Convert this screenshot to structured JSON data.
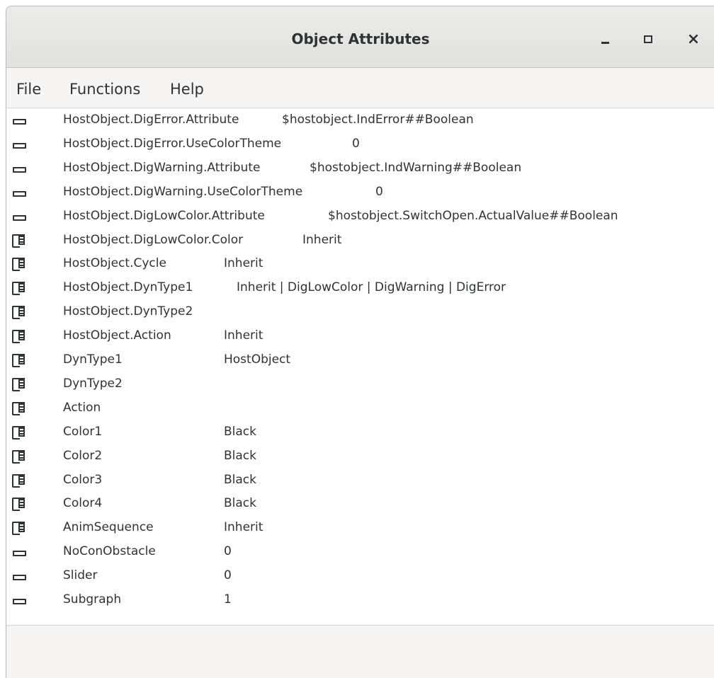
{
  "window": {
    "title": "Object Attributes"
  },
  "menu": [
    "File",
    "Functions",
    "Help"
  ],
  "rows": [
    {
      "icon": "attribute-icon",
      "name": "HostObject.DigError.Attribute",
      "value": "$hostobject.IndError##Boolean"
    },
    {
      "icon": "attribute-icon",
      "name": "HostObject.DigError.UseColorTheme",
      "value": "0"
    },
    {
      "icon": "attribute-icon",
      "name": "HostObject.DigWarning.Attribute",
      "value": "$hostobject.IndWarning##Boolean"
    },
    {
      "icon": "attribute-icon",
      "name": "HostObject.DigWarning.UseColorTheme",
      "value": "0"
    },
    {
      "icon": "attribute-icon",
      "name": "HostObject.DigLowColor.Attribute",
      "value": "$hostobject.SwitchOpen.ActualValue##Boolean"
    },
    {
      "icon": "folder-icon",
      "name": "HostObject.DigLowColor.Color",
      "value": "Inherit"
    },
    {
      "icon": "folder-icon",
      "name": "HostObject.Cycle",
      "value": "Inherit"
    },
    {
      "icon": "folder-icon",
      "name": "HostObject.DynType1",
      "value": "Inherit | DigLowColor | DigWarning | DigError"
    },
    {
      "icon": "folder-icon",
      "name": "HostObject.DynType2",
      "value": ""
    },
    {
      "icon": "folder-icon",
      "name": "HostObject.Action",
      "value": "Inherit"
    },
    {
      "icon": "folder-icon",
      "name": "DynType1",
      "value": "HostObject"
    },
    {
      "icon": "folder-icon",
      "name": "DynType2",
      "value": ""
    },
    {
      "icon": "folder-icon",
      "name": "Action",
      "value": ""
    },
    {
      "icon": "folder-icon",
      "name": "Color1",
      "value": "Black"
    },
    {
      "icon": "folder-icon",
      "name": "Color2",
      "value": "Black"
    },
    {
      "icon": "folder-icon",
      "name": "Color3",
      "value": "Black"
    },
    {
      "icon": "folder-icon",
      "name": "Color4",
      "value": "Black"
    },
    {
      "icon": "folder-icon",
      "name": "AnimSequence",
      "value": "Inherit"
    },
    {
      "icon": "attribute-icon",
      "name": "NoConObstacle",
      "value": "0"
    },
    {
      "icon": "attribute-icon",
      "name": "Slider",
      "value": "0"
    },
    {
      "icon": "attribute-icon",
      "name": "Subgraph",
      "value": "1"
    }
  ]
}
